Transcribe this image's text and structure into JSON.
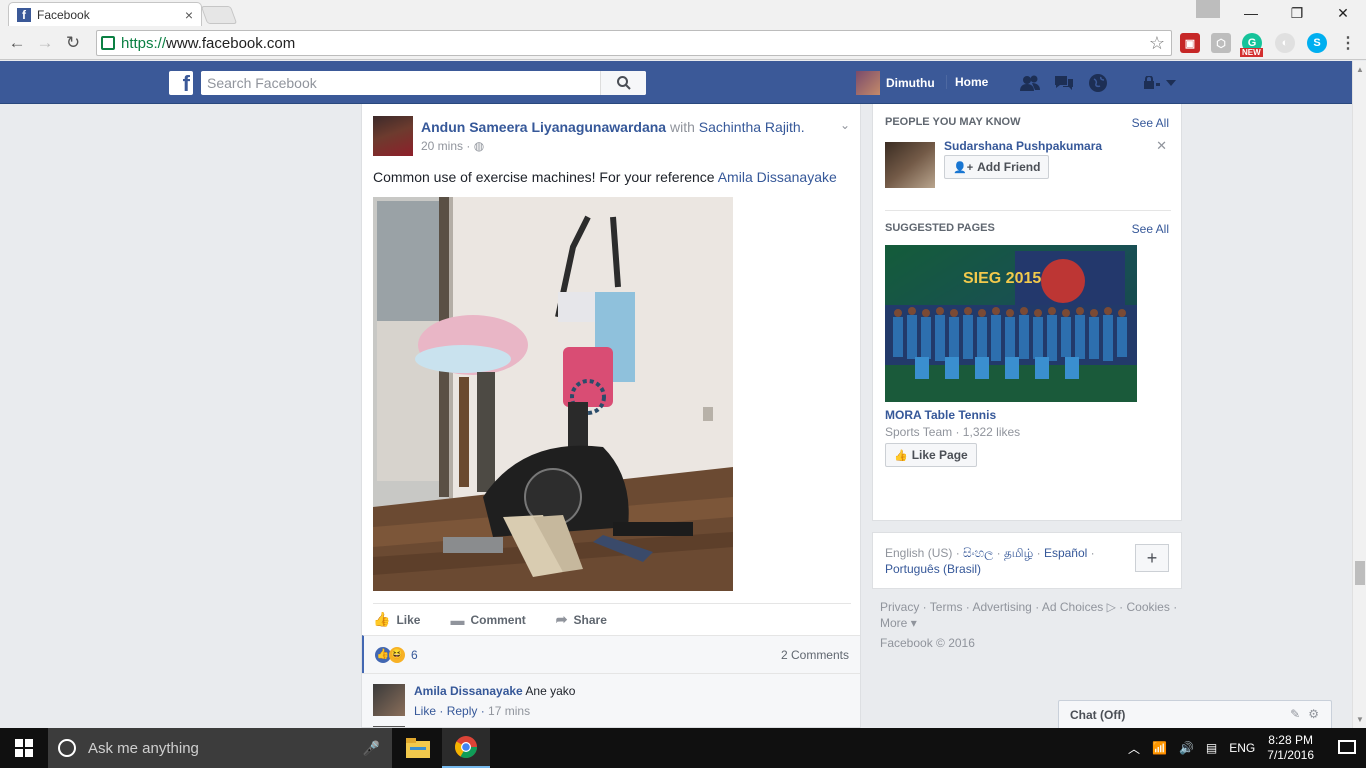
{
  "browser": {
    "tab_title": "Facebook",
    "tab_close": "×",
    "url_scheme": "https://",
    "url_host": "www.facebook.com",
    "window_buttons": [
      "—",
      "❐",
      "✕"
    ],
    "extensions": [
      {
        "name": "translate-extension-icon",
        "color": "#c62828",
        "glyph": "▣"
      },
      {
        "name": "box-extension-icon",
        "color": "#9e9e9e",
        "glyph": "⬡"
      },
      {
        "name": "grammarly-extension-icon",
        "color": "#15c39a",
        "glyph": "G"
      },
      {
        "name": "grey-extension-icon",
        "color": "#cfcfcf",
        "glyph": "◐"
      },
      {
        "name": "skype-extension-icon",
        "color": "#00aff0",
        "glyph": "S"
      },
      {
        "name": "menu-icon",
        "color": "#f1f1f1",
        "glyph": "⋮"
      }
    ],
    "new_badge": "NEW"
  },
  "fb": {
    "search_placeholder": "Search Facebook",
    "profile_name": "Dimuthu",
    "home_label": "Home",
    "brand_color": "#3b5998"
  },
  "post": {
    "author": "Andun Sameera Liyanagunawardana",
    "with_text": "with",
    "tagged": "Sachintha Rajith.",
    "time": "20 mins",
    "text": "Common use of exercise machines! For your reference",
    "mention": "Amila Dissanayake",
    "actions": {
      "like": "Like",
      "comment": "Comment",
      "share": "Share"
    },
    "reaction_count": "6",
    "comments_count": "2 Comments",
    "comment": {
      "author": "Amila Dissanayake",
      "text": "Ane yako",
      "like": "Like",
      "reply": "Reply",
      "time": "17 mins"
    }
  },
  "sidebar": {
    "pymk_heading": "PEOPLE YOU MAY KNOW",
    "see_all": "See All",
    "pymk_name": "Sudarshana Pushpakumara",
    "add_friend": "Add Friend",
    "suggested_heading": "SUGGESTED PAGES",
    "page_name": "MORA Table Tennis",
    "page_meta": "Sports Team · 1,322 likes",
    "like_page": "Like Page",
    "image_caption": "SIEG 2015"
  },
  "languages": {
    "current": "English (US)",
    "others": [
      "සිංහල",
      "தமிழ்",
      "Español",
      "Português (Brasil)"
    ]
  },
  "footer": {
    "links": [
      "Privacy",
      "Terms",
      "Advertising",
      "Ad Choices",
      "Cookies",
      "More"
    ],
    "copyright": "Facebook © 2016"
  },
  "chat": {
    "label": "Chat (Off)"
  },
  "taskbar": {
    "search_text": "Ask me anything",
    "language": "ENG",
    "time": "8:28 PM",
    "date": "7/1/2016"
  }
}
